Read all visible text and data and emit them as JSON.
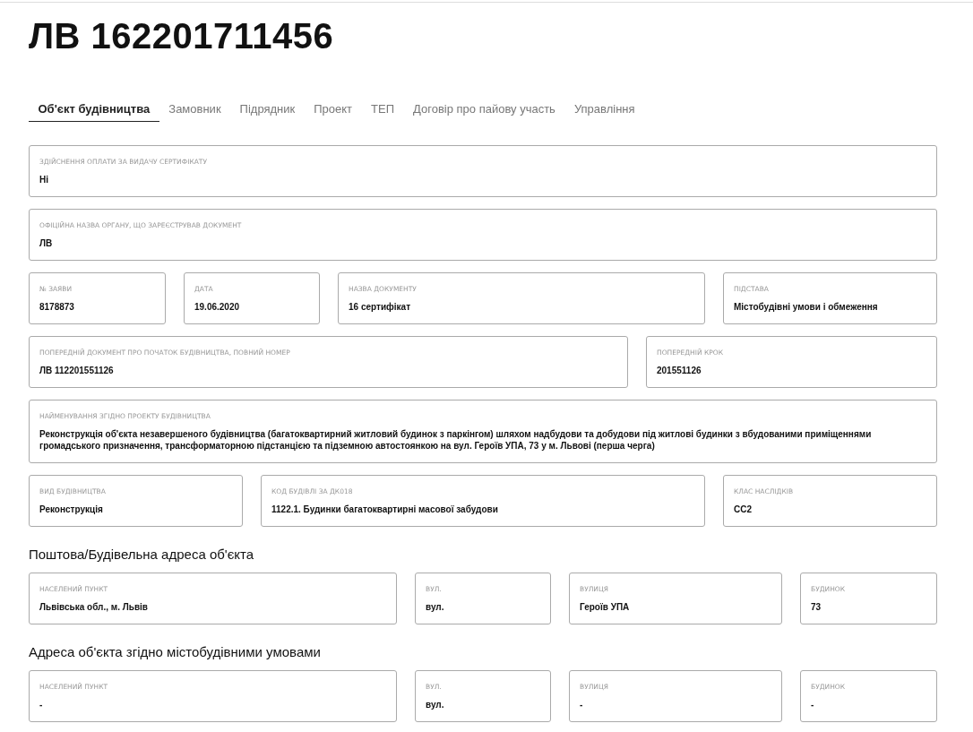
{
  "title": "ЛВ 162201711456",
  "tabs": [
    {
      "label": "Об'єкт будівництва",
      "selected": true
    },
    {
      "label": "Замовник",
      "selected": false
    },
    {
      "label": "Підрядник",
      "selected": false
    },
    {
      "label": "Проект",
      "selected": false
    },
    {
      "label": "ТЕП",
      "selected": false
    },
    {
      "label": "Договір про пайову участь",
      "selected": false
    },
    {
      "label": "Управління",
      "selected": false
    }
  ],
  "field_rows": [
    [
      {
        "label": "ЗДІЙСНЕННЯ ОПЛАТИ ЗА ВИДАЧУ СЕРТИФІКАТУ",
        "value": "Ні"
      }
    ],
    [
      {
        "label": "ОФІЦІЙНА НАЗВА ОРГАНУ, ЩО ЗАРЕЄСТРУВАВ ДОКУМЕНТ",
        "value": "ЛВ"
      }
    ],
    [
      {
        "label": "№ ЗАЯВИ",
        "value": "8178873"
      },
      {
        "label": "ДАТА",
        "value": "19.06.2020"
      },
      {
        "label": "НАЗВА ДОКУМЕНТУ",
        "value": "16 сертифікат"
      },
      {
        "label": "ПІДСТАВА",
        "value": "Містобудівні умови і обмеження"
      }
    ],
    [
      {
        "label": "ПОПЕРЕДНІЙ ДОКУМЕНТ ПРО ПОЧАТОК БУДІВНИЦТВА, ПОВНИЙ НОМЕР",
        "value": "ЛВ 112201551126"
      },
      {
        "label": "ПОПЕРЕДНІЙ КРОК",
        "value": "201551126"
      }
    ],
    [
      {
        "label": "НАЙМЕНУВАННЯ ЗГІДНО ПРОЕКТУ БУДІВНИЦТВА",
        "value": "Реконструкція об'єкта незавершеного будівництва (багатоквартирний житловий будинок з паркінгом) шляхом надбудови та добудови під житлові будинки з вбудованими приміщеннями громадського призначення, трансформаторною підстанцією та підземною автостоянкою на вул. Героїв УПА, 73 у м. Львові (перша черга)"
      }
    ],
    [
      {
        "label": "ВИД БУДІВНИЦТВА",
        "value": "Реконструкція"
      },
      {
        "label": "КОД БУДІВЛІ ЗА ДК018",
        "value": "1122.1. Будинки багатоквартирні масової забудови"
      },
      {
        "label": "КЛАС НАСЛІДКІВ",
        "value": "СС2"
      }
    ]
  ],
  "address_sections": [
    {
      "heading": "Поштова/Будівельна адреса об'єкта",
      "fields": [
        {
          "label": "НАСЕЛЕНИЙ ПУНКТ",
          "value": "Львівська обл., м. Львів"
        },
        {
          "label": "ВУЛ.",
          "value": "вул."
        },
        {
          "label": "ВУЛИЦЯ",
          "value": "Героїв УПА"
        },
        {
          "label": "БУДИНОК",
          "value": "73"
        }
      ]
    },
    {
      "heading": "Адреса об'єкта згідно містобудівними умовами",
      "fields": [
        {
          "label": "НАСЕЛЕНИЙ ПУНКТ",
          "value": "-"
        },
        {
          "label": "ВУЛ.",
          "value": "вул."
        },
        {
          "label": "ВУЛИЦЯ",
          "value": "-"
        },
        {
          "label": "БУДИНОК",
          "value": "-"
        }
      ]
    }
  ]
}
